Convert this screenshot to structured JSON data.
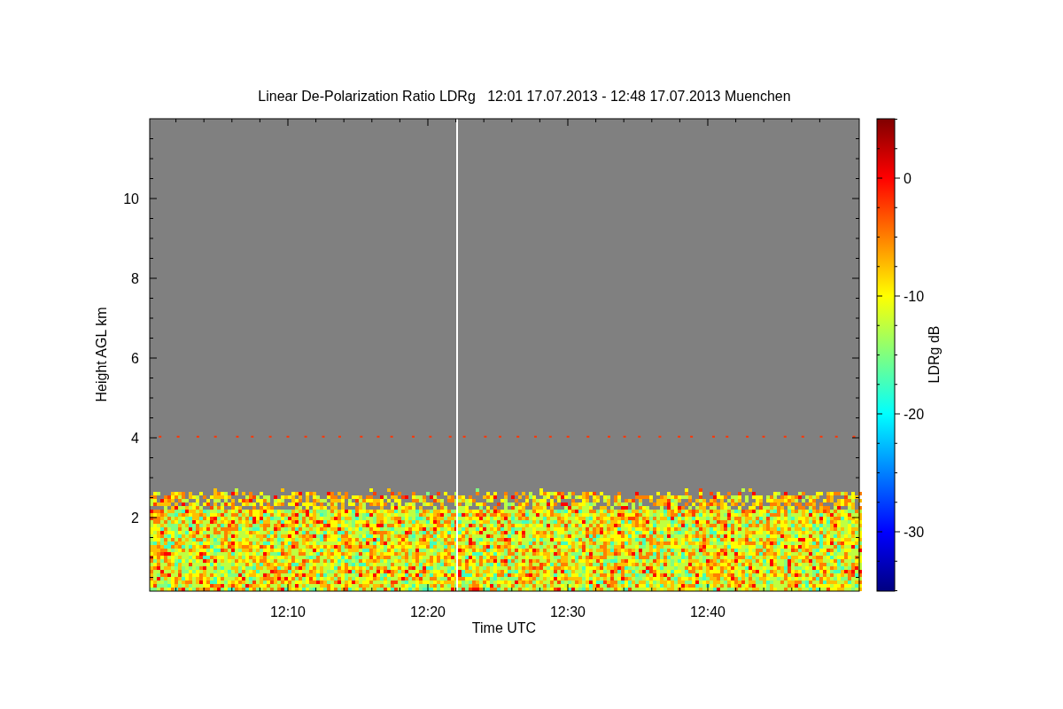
{
  "title": "Linear De-Polarization Ratio LDRg   12:01 17.07.2013 - 12:48 17.07.2013 Muenchen",
  "y_axis": {
    "label": "Height AGL km",
    "ticks": [
      "10",
      "8",
      "6",
      "4",
      "2"
    ]
  },
  "x_axis": {
    "label": "Time UTC",
    "ticks": [
      "12:10",
      "12:20",
      "12:30",
      "12:40"
    ]
  },
  "colorbar": {
    "label": "LDRg dB",
    "ticks": [
      "0",
      "-10",
      "-20",
      "-30"
    ]
  }
}
